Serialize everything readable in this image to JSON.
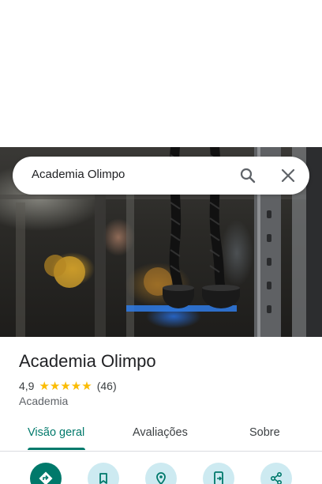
{
  "search": {
    "query": "Academia Olimpo"
  },
  "place": {
    "name": "Academia Olimpo",
    "rating": "4,9",
    "stars": "★★★★★",
    "reviews": "(46)",
    "category": "Academia"
  },
  "tabs": [
    {
      "label": "Visão geral",
      "active": true
    },
    {
      "label": "Avaliações",
      "active": false
    },
    {
      "label": "Sobre",
      "active": false
    }
  ],
  "colors": {
    "accent": "#00796b",
    "star": "#fbbc04",
    "action_bg": "#cdeaf1"
  },
  "actions": [
    "directions-icon",
    "save-icon",
    "nearby-icon",
    "send-to-phone-icon",
    "share-icon"
  ]
}
